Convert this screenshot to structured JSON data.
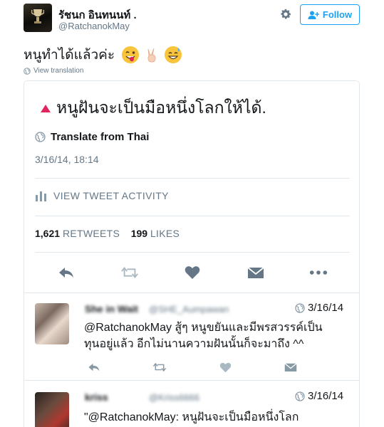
{
  "header": {
    "display_name": "รัชนก อินทนนท์ .",
    "username": "@RatchanokMay",
    "follow_label": "Follow"
  },
  "tweet": {
    "text": "หนูทำได้แล้วค่ะ",
    "emojis": [
      "winking-face-tongue",
      "victory-hand",
      "grinning-sweat-face"
    ],
    "view_translation": "View translation"
  },
  "quoted": {
    "text": "หนูฝันจะเป็นมือหนึ่งโลกให้ได้.",
    "translate_label": "Translate from Thai",
    "timestamp": "3/16/14, 18:14",
    "activity_label": "VIEW TWEET ACTIVITY",
    "retweets_count": "1,621",
    "retweets_label": "RETWEETS",
    "likes_count": "199",
    "likes_label": "LIKES"
  },
  "replies": [
    {
      "name": "She in Wait",
      "handle": "@SHE_Aumpawan",
      "date": "3/16/14",
      "text_line1": "@RatchanokMay สู้ๆ หนูขยันและมีพรสวรรค์เป็น",
      "text_line2": "ทุนอยู่แล้ว อีกไม่นานความฝันนั้นก็จะมาถึง ^^"
    },
    {
      "name": "kriss",
      "handle": "@Kriss6666",
      "date": "3/16/14",
      "text_line1": "\"@RatchanokMay: หนูฝันจะเป็นมือหนึ่งโลก"
    }
  ],
  "colors": {
    "accent": "#1da1f2",
    "muted": "#657786",
    "icon": "#8899a6",
    "divider": "#e1e8ed",
    "alert": "#e0245e"
  }
}
